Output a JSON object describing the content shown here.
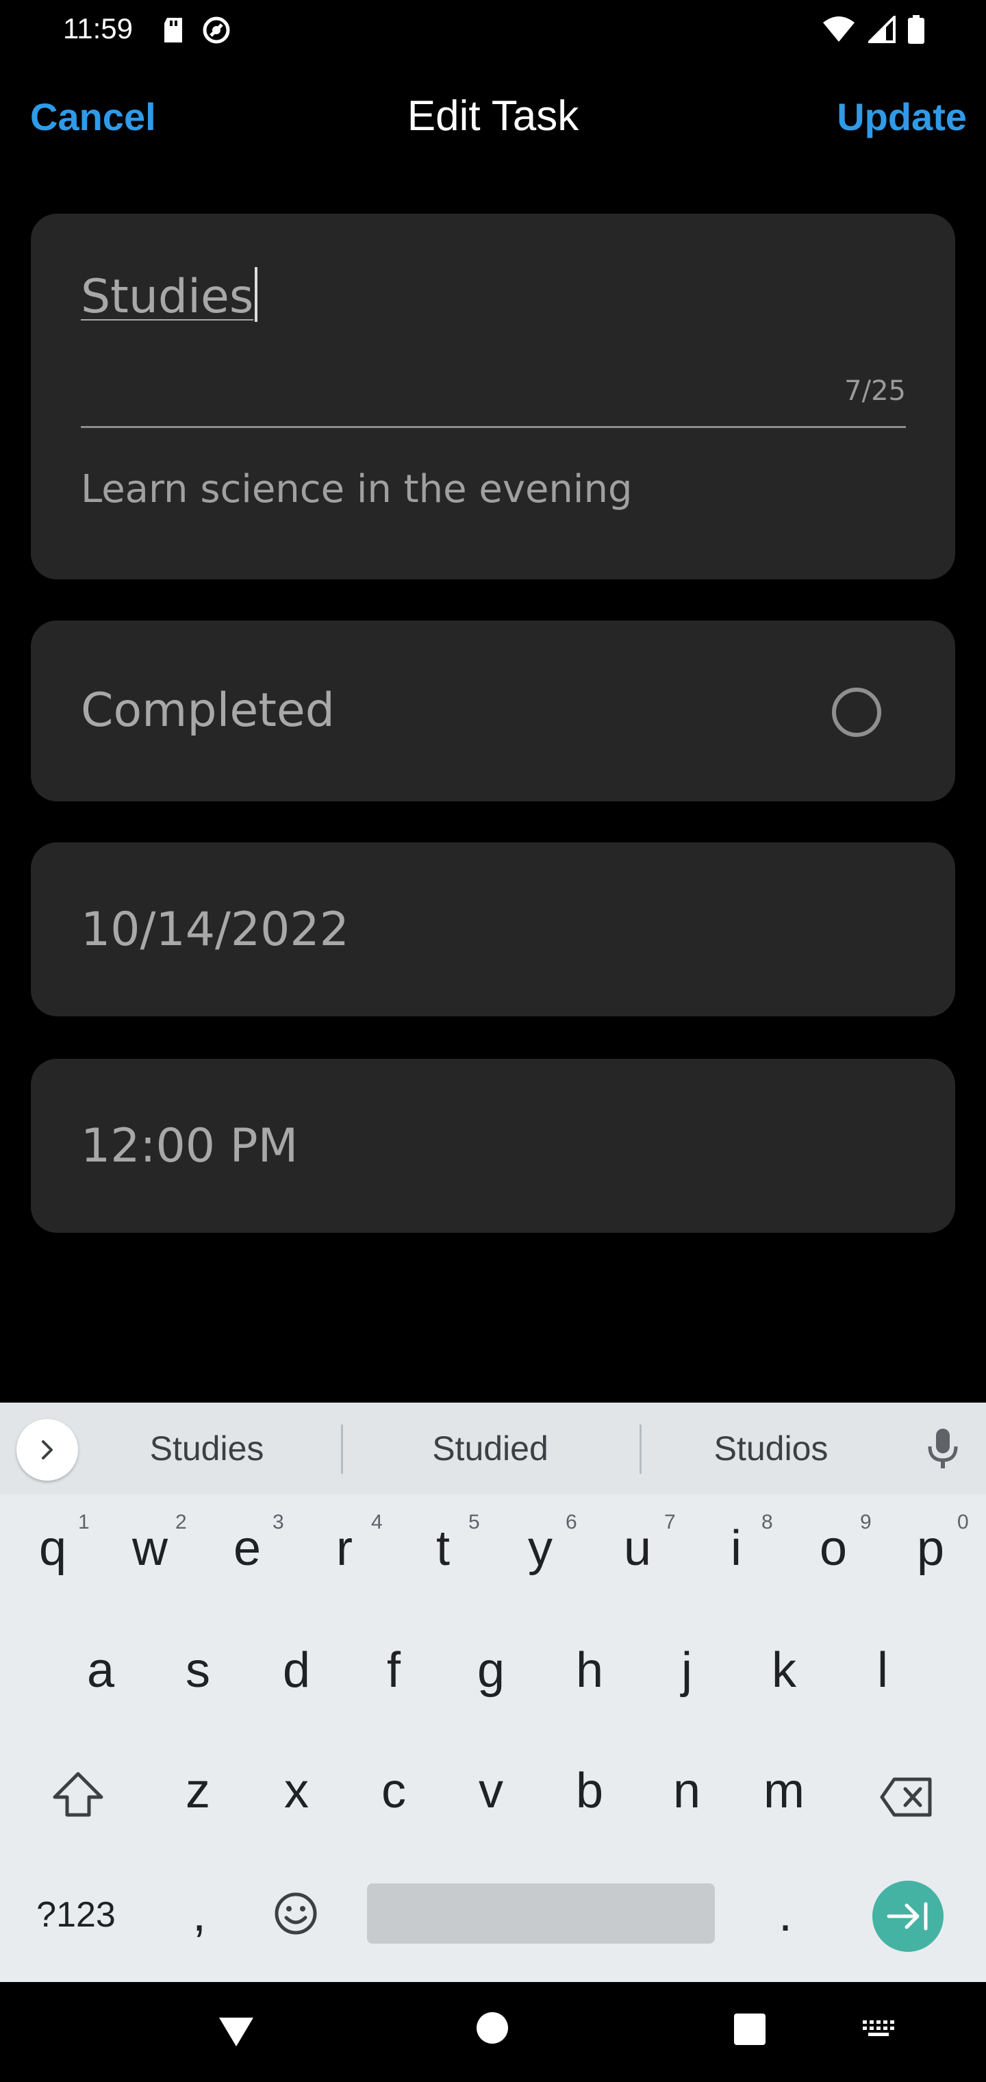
{
  "status_bar": {
    "time": "11:59",
    "icons": [
      "sd-card-icon",
      "sync-icon",
      "wifi-icon",
      "signal-icon",
      "battery-icon"
    ]
  },
  "header": {
    "cancel_label": "Cancel",
    "title": "Edit Task",
    "update_label": "Update",
    "accent_color": "#2f9be8"
  },
  "task": {
    "title_value": "Studies",
    "char_count": "7/25",
    "description": "Learn science in the evening",
    "completed_label": "Completed",
    "completed": false,
    "date": "10/14/2022",
    "time": "12:00 PM"
  },
  "keyboard": {
    "suggestions": [
      "Studies",
      "Studied",
      "Studios"
    ],
    "row1": [
      "q",
      "w",
      "e",
      "r",
      "t",
      "y",
      "u",
      "i",
      "o",
      "p"
    ],
    "row1_hints": [
      "1",
      "2",
      "3",
      "4",
      "5",
      "6",
      "7",
      "8",
      "9",
      "0"
    ],
    "row2": [
      "a",
      "s",
      "d",
      "f",
      "g",
      "h",
      "j",
      "k",
      "l"
    ],
    "row3": [
      "z",
      "x",
      "c",
      "v",
      "b",
      "n",
      "m"
    ],
    "symbols_label": "?123",
    "comma": ",",
    "period": ".",
    "enter_color": "#45b3a4"
  },
  "nav_bar": {
    "icons": [
      "back-icon",
      "home-icon",
      "recents-icon",
      "keyboard-switch-icon"
    ]
  }
}
